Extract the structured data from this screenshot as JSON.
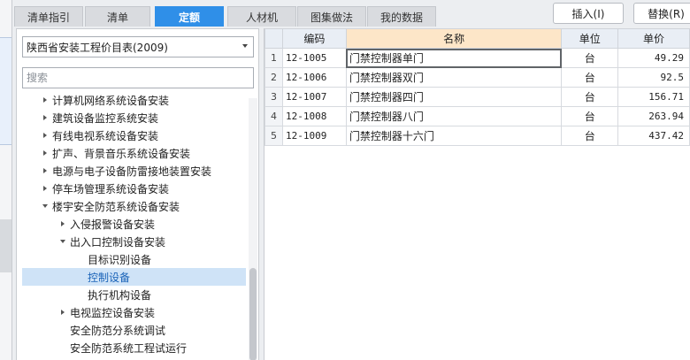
{
  "tabs": [
    {
      "label": "清单指引",
      "active": false
    },
    {
      "label": "清单",
      "active": false
    },
    {
      "label": "定额",
      "active": true
    },
    {
      "label": "人材机",
      "active": false
    },
    {
      "label": "图集做法",
      "active": false
    },
    {
      "label": "我的数据",
      "active": false
    }
  ],
  "toolbar": {
    "insert_label": "插入(I)",
    "replace_label": "替换(R)"
  },
  "catalog": {
    "selected": "陕西省安装工程价目表(2009)"
  },
  "search": {
    "placeholder": "搜索"
  },
  "tree": [
    {
      "label": "计算机网络系统设备安装",
      "expander": "collapsed",
      "selected": false
    },
    {
      "label": "建筑设备监控系统安装",
      "expander": "collapsed",
      "selected": false
    },
    {
      "label": "有线电视系统设备安装",
      "expander": "collapsed",
      "selected": false
    },
    {
      "label": "扩声、背景音乐系统设备安装",
      "expander": "collapsed",
      "selected": false
    },
    {
      "label": "电源与电子设备防雷接地装置安装",
      "expander": "collapsed",
      "selected": false
    },
    {
      "label": "停车场管理系统设备安装",
      "expander": "collapsed",
      "selected": false
    },
    {
      "label": "楼宇安全防范系统设备安装",
      "expander": "expanded",
      "selected": false
    },
    {
      "label": "入侵报警设备安装",
      "expander": "collapsed",
      "selected": false
    },
    {
      "label": "出入口控制设备安装",
      "expander": "expanded",
      "selected": false
    },
    {
      "label": "目标识别设备",
      "expander": "none",
      "selected": false
    },
    {
      "label": "控制设备",
      "expander": "none",
      "selected": true
    },
    {
      "label": "执行机构设备",
      "expander": "none",
      "selected": false
    },
    {
      "label": "电视监控设备安装",
      "expander": "collapsed",
      "selected": false
    },
    {
      "label": "安全防范分系统调试",
      "expander": "none",
      "selected": false
    },
    {
      "label": "安全防范系统工程试运行",
      "expander": "none",
      "selected": false
    }
  ],
  "grid": {
    "headers": {
      "code": "编码",
      "name": "名称",
      "unit": "单位",
      "price": "单价"
    },
    "rows": [
      {
        "index": "1",
        "code": "12-1005",
        "name": "门禁控制器单门",
        "unit": "台",
        "price": "49.29"
      },
      {
        "index": "2",
        "code": "12-1006",
        "name": "门禁控制器双门",
        "unit": "台",
        "price": "92.5"
      },
      {
        "index": "3",
        "code": "12-1007",
        "name": "门禁控制器四门",
        "unit": "台",
        "price": "156.71"
      },
      {
        "index": "4",
        "code": "12-1008",
        "name": "门禁控制器八门",
        "unit": "台",
        "price": "263.94"
      },
      {
        "index": "5",
        "code": "12-1009",
        "name": "门禁控制器十六门",
        "unit": "台",
        "price": "437.42"
      }
    ]
  },
  "colors": {
    "accent": "#2f8fe8",
    "selection": "#cfe3f7",
    "name_header": "#fde6c8"
  }
}
